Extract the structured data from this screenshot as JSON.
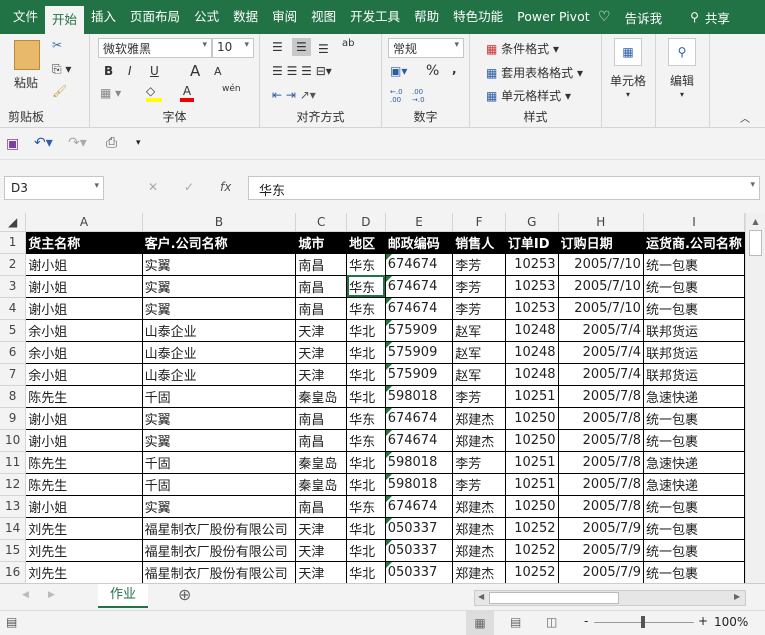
{
  "ribbon_tabs": [
    "文件",
    "开始",
    "插入",
    "页面布局",
    "公式",
    "数据",
    "审阅",
    "视图",
    "开发工具",
    "帮助",
    "特色功能",
    "Power Pivot"
  ],
  "active_tab": "开始",
  "tell_me": "告诉我",
  "share": "共享",
  "clipboard": {
    "paste": "粘贴",
    "label": "剪贴板"
  },
  "font": {
    "name": "微软雅黑",
    "size": "10",
    "bold": "B",
    "italic": "I",
    "underline": "U",
    "grow": "A",
    "shrink": "A",
    "color_letter": "A",
    "phonetic": "wén",
    "label": "字体",
    "fill_color": "#ffff00",
    "font_color": "#ff0000"
  },
  "alignment": {
    "wrap": "ab",
    "label": "对齐方式"
  },
  "number": {
    "format": "常规",
    "percent": "%",
    "comma": ",",
    "inc": "←.0\n.00",
    "dec": ".00\n→.0",
    "label": "数字"
  },
  "styles": {
    "conditional": "条件格式",
    "table": "套用表格格式",
    "cell": "单元格样式",
    "label": "样式"
  },
  "cells": {
    "label": "单元格"
  },
  "editing": {
    "label": "编辑"
  },
  "formula_bar": {
    "name_box": "D3",
    "fx": "fx",
    "value": "华东"
  },
  "columns": [
    "A",
    "B",
    "C",
    "D",
    "E",
    "F",
    "G",
    "H",
    "I"
  ],
  "header_row": [
    "货主名称",
    "客户.公司名称",
    "城市",
    "地区",
    "邮政编码",
    "销售人",
    "订单ID",
    "订购日期",
    "运货商.公司名称"
  ],
  "rows": [
    [
      "谢小姐",
      "实翼",
      "南昌",
      "华东",
      "674674",
      "李芳",
      "10253",
      "2005/7/10",
      "统一包裹"
    ],
    [
      "谢小姐",
      "实翼",
      "南昌",
      "华东",
      "674674",
      "李芳",
      "10253",
      "2005/7/10",
      "统一包裹"
    ],
    [
      "谢小姐",
      "实翼",
      "南昌",
      "华东",
      "674674",
      "李芳",
      "10253",
      "2005/7/10",
      "统一包裹"
    ],
    [
      "余小姐",
      "山泰企业",
      "天津",
      "华北",
      "575909",
      "赵军",
      "10248",
      "2005/7/4",
      "联邦货运"
    ],
    [
      "余小姐",
      "山泰企业",
      "天津",
      "华北",
      "575909",
      "赵军",
      "10248",
      "2005/7/4",
      "联邦货运"
    ],
    [
      "余小姐",
      "山泰企业",
      "天津",
      "华北",
      "575909",
      "赵军",
      "10248",
      "2005/7/4",
      "联邦货运"
    ],
    [
      "陈先生",
      "千固",
      "秦皇岛",
      "华北",
      "598018",
      "李芳",
      "10251",
      "2005/7/8",
      "急速快递"
    ],
    [
      "谢小姐",
      "实翼",
      "南昌",
      "华东",
      "674674",
      "郑建杰",
      "10250",
      "2005/7/8",
      "统一包裹"
    ],
    [
      "谢小姐",
      "实翼",
      "南昌",
      "华东",
      "674674",
      "郑建杰",
      "10250",
      "2005/7/8",
      "统一包裹"
    ],
    [
      "陈先生",
      "千固",
      "秦皇岛",
      "华北",
      "598018",
      "李芳",
      "10251",
      "2005/7/8",
      "急速快递"
    ],
    [
      "陈先生",
      "千固",
      "秦皇岛",
      "华北",
      "598018",
      "李芳",
      "10251",
      "2005/7/8",
      "急速快递"
    ],
    [
      "谢小姐",
      "实翼",
      "南昌",
      "华东",
      "674674",
      "郑建杰",
      "10250",
      "2005/7/8",
      "统一包裹"
    ],
    [
      "刘先生",
      "福星制衣厂股份有限公司",
      "天津",
      "华北",
      "050337",
      "郑建杰",
      "10252",
      "2005/7/9",
      "统一包裹"
    ],
    [
      "刘先生",
      "福星制衣厂股份有限公司",
      "天津",
      "华北",
      "050337",
      "郑建杰",
      "10252",
      "2005/7/9",
      "统一包裹"
    ],
    [
      "刘先生",
      "福星制衣厂股份有限公司",
      "天津",
      "华北",
      "050337",
      "郑建杰",
      "10252",
      "2005/7/9",
      "统一包裹"
    ]
  ],
  "sheet_tabs": [
    "作业"
  ],
  "zoom": "100%",
  "accent": "#217346"
}
